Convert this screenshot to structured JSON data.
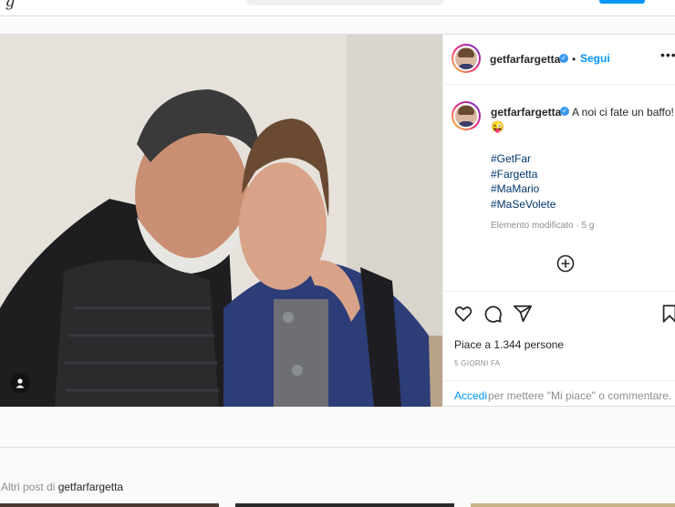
{
  "nav": {
    "logo_fragment": "g"
  },
  "post": {
    "username": "getfarfargetta",
    "verified": true,
    "separator": "•",
    "follow_label": "Segui",
    "more_label": "•••",
    "caption": "A noi ci fate un baffo!",
    "caption_emoji": "😜",
    "hashtags": [
      "#GetFar",
      "#Fargetta",
      "#MaMario",
      "#MaSeVolete"
    ],
    "edited_note": "Elemento modificato · 5 g",
    "likes_text": "Piace a 1.344 persone",
    "date_text": "5 GIORNI FA",
    "login_link": "Accedi",
    "login_rest": "per mettere \"Mi piace\" o commentare."
  },
  "more_posts": {
    "prefix": "Altri post di",
    "username": "getfarfargetta"
  },
  "colors": {
    "accent": "#0095f6",
    "hashtag": "#00376b",
    "muted": "#8e8e8e"
  }
}
